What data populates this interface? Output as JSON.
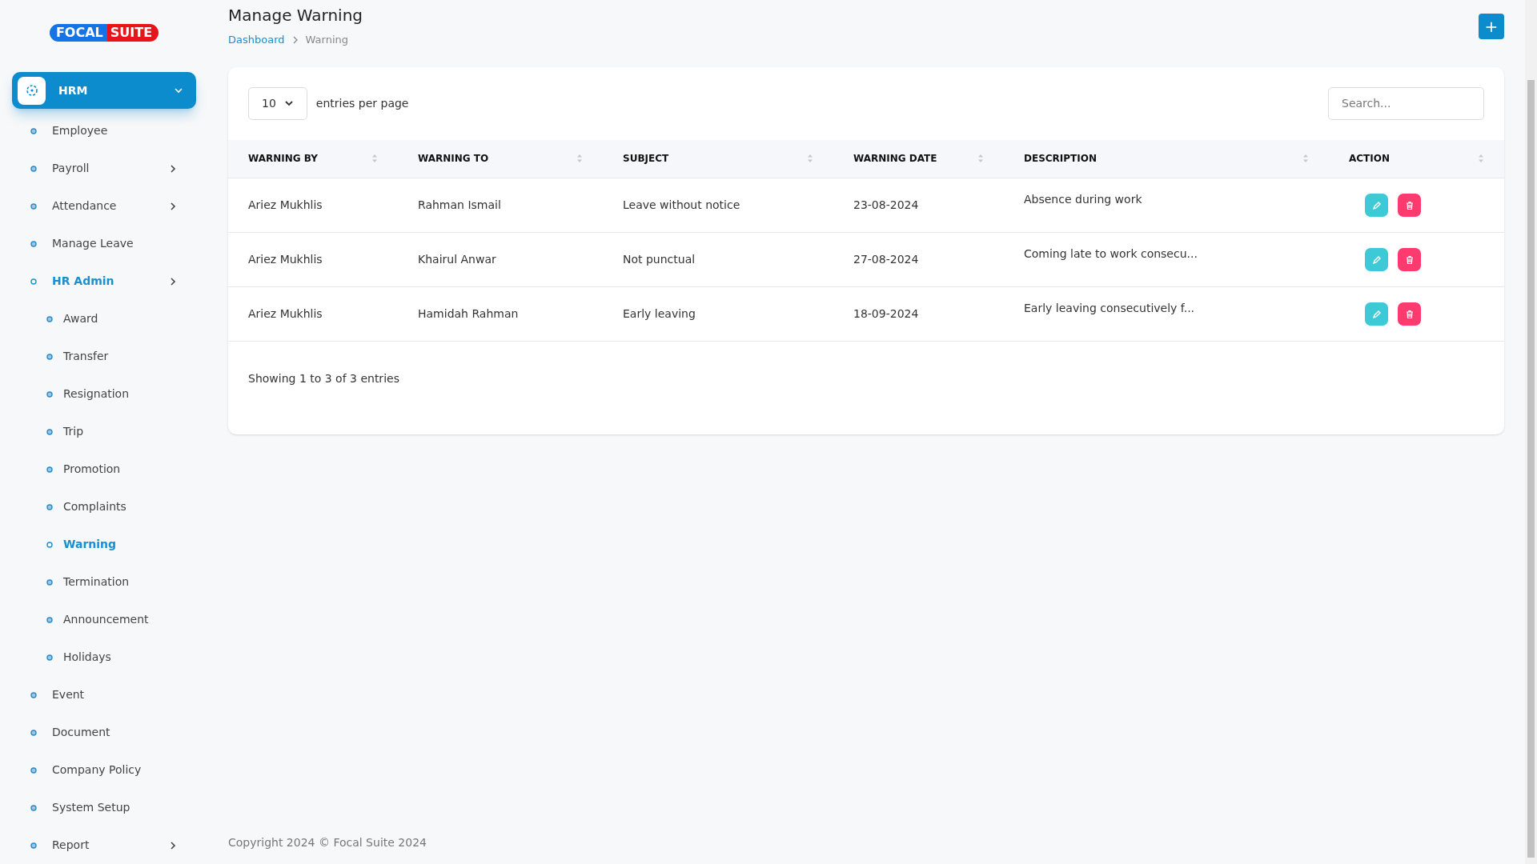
{
  "logo": {
    "part_1": "FOCAL",
    "part_2": "SUITE"
  },
  "sidebar": {
    "module": {
      "label": "HRM",
      "expanded": true
    },
    "items": [
      {
        "label": "Employee",
        "selected": false,
        "submenu": false
      },
      {
        "label": "Payroll",
        "selected": false,
        "submenu": true
      },
      {
        "label": "Attendance",
        "selected": false,
        "submenu": true
      },
      {
        "label": "Manage Leave",
        "selected": false,
        "submenu": false
      },
      {
        "label": "HR Admin",
        "selected": true,
        "submenu": true,
        "children": [
          {
            "label": "Award",
            "selected": false
          },
          {
            "label": "Transfer",
            "selected": false
          },
          {
            "label": "Resignation",
            "selected": false
          },
          {
            "label": "Trip",
            "selected": false
          },
          {
            "label": "Promotion",
            "selected": false
          },
          {
            "label": "Complaints",
            "selected": false
          },
          {
            "label": "Warning",
            "selected": true
          },
          {
            "label": "Termination",
            "selected": false
          },
          {
            "label": "Announcement",
            "selected": false
          },
          {
            "label": "Holidays",
            "selected": false
          }
        ]
      },
      {
        "label": "Event",
        "selected": false,
        "submenu": false
      },
      {
        "label": "Document",
        "selected": false,
        "submenu": false
      },
      {
        "label": "Company Policy",
        "selected": false,
        "submenu": false
      },
      {
        "label": "System Setup",
        "selected": false,
        "submenu": false
      },
      {
        "label": "Report",
        "selected": false,
        "submenu": true
      }
    ]
  },
  "page": {
    "title": "Manage Warning",
    "breadcrumb": [
      "Dashboard",
      "Warning"
    ],
    "add_button": "+"
  },
  "table": {
    "page_size": "10",
    "page_size_label": "entries per page",
    "search": {
      "placeholder": "Search..."
    },
    "columns": [
      "WARNING BY",
      "WARNING TO",
      "SUBJECT",
      "WARNING DATE",
      "DESCRIPTION",
      "ACTION"
    ],
    "rows": [
      {
        "warning_by": "Ariez Mukhlis",
        "warning_to": "Rahman Ismail",
        "subject": "Leave without notice",
        "date": "23-08-2024",
        "description": "Absence during work"
      },
      {
        "warning_by": "Ariez Mukhlis",
        "warning_to": "Khairul Anwar",
        "subject": "Not punctual",
        "date": "27-08-2024",
        "description": "Coming late to work consecu..."
      },
      {
        "warning_by": "Ariez Mukhlis",
        "warning_to": "Hamidah Rahman",
        "subject": "Early leaving",
        "date": "18-09-2024",
        "description": "Early leaving consecutively f..."
      }
    ],
    "summary": "Showing 1 to 3 of 3 entries"
  },
  "footer": "Copyright 2024 © Focal Suite 2024"
}
